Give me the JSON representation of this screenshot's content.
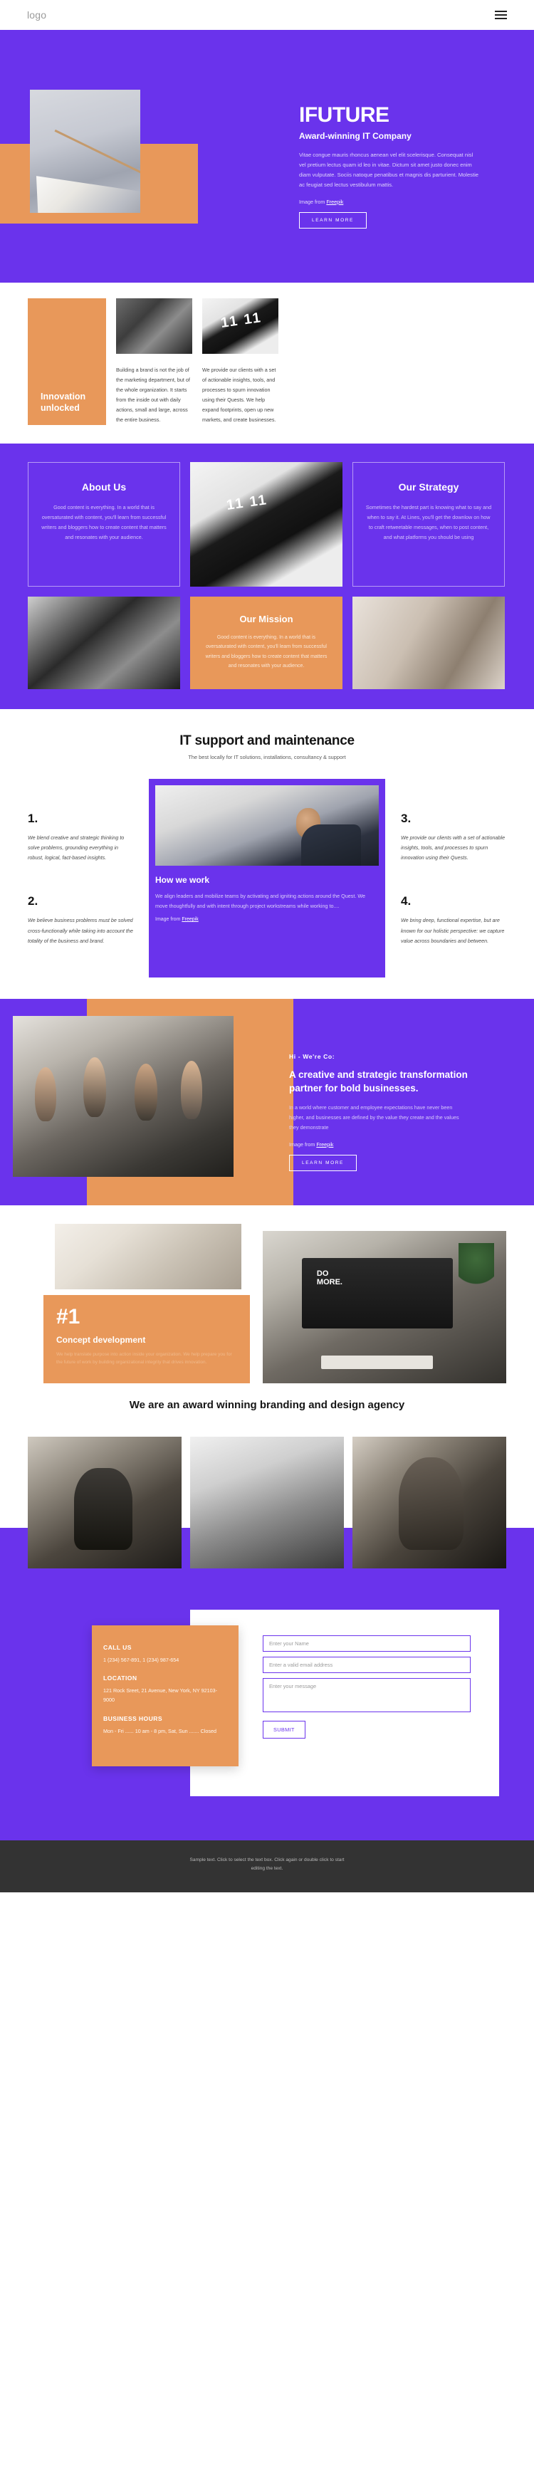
{
  "header": {
    "logo": "logo",
    "menu_icon": "hamburger-icon"
  },
  "hero": {
    "title": "IFUTURE",
    "subtitle": "Award-winning IT Company",
    "paragraph": "Vitae congue mauris rhoncus aenean vel elit scelerisque. Consequat nisl vel pretium lectus quam id leo in vitae. Dictum sit amet justo donec enim diam vulputate. Sociis natoque penatibus et magnis dis parturient. Molestie ac feugiat sed lectus vestibulum mattis.",
    "credit_prefix": "Image from ",
    "credit_link": "Freepik",
    "cta": "LEARN MORE"
  },
  "innovation": {
    "heading": "Innovation unlocked",
    "columns": [
      "Building a brand is not the job of the marketing department, but of the whole organization. It starts from the inside out with daily actions, small and large, across the entire business.",
      "We provide our clients with a set of actionable insights, tools, and processes to spurn innovation using their Quests. We help expand footprints, open up new markets, and create businesses."
    ]
  },
  "about": {
    "cards": [
      {
        "title": "About Us",
        "text": "Good content is everything. In a world that is oversaturated with content, you'll learn from successful writers and bloggers how to create content that matters and resonates with your audience."
      },
      {
        "title": "Our Strategy",
        "text": "Sometimes the hardest part is knowing what to say and when to say it. At Lines, you'll get the downlow on how to craft retweetable messages, when to post content, and what platforms you should be using"
      }
    ],
    "mission": {
      "title": "Our Mission",
      "text": "Good content is everything. In a world that is oversaturated with content, you'll learn from successful writers and bloggers how to create content that matters and resonates with your audience."
    }
  },
  "support": {
    "title": "IT support and maintenance",
    "lead": "The best locally for IT solutions, installations, consultancy & support",
    "items": [
      {
        "num": "1.",
        "text": "We blend creative and strategic thinking to solve problems, grounding everything in robust, logical, fact-based insights."
      },
      {
        "num": "2.",
        "text": "We believe business problems must be solved cross-functionally while taking into account the totality of the business and brand."
      },
      {
        "num": "3.",
        "text": "We provide our clients with a set of actionable insights, tools, and processes to spurn innovation using their Quests."
      },
      {
        "num": "4.",
        "text": "We bring deep, functional expertise, but are known for our holistic perspective: we capture value across boundaries and between."
      }
    ],
    "work": {
      "title": "How we work",
      "text": "We align leaders and mobilize teams by activating and igniting actions around the Quest. We move thoughtfully and with intent through project workstreams while working to....",
      "credit_prefix": "Image from ",
      "credit_link": "Freepik"
    }
  },
  "creative": {
    "eyebrow": "Hi - We're Co:",
    "title": "A creative and strategic transformation partner for bold businesses.",
    "text": "In a world where customer and employee expectations have never been higher, and businesses are defined by the value they create and the values they demonstrate",
    "credit_prefix": "Image from ",
    "credit_link": "Freepik",
    "cta": "LEARN MORE"
  },
  "concept": {
    "hash": "#1",
    "title": "Concept development",
    "text": "We help translate purpose into action inside your organization. We help prepare you for the future of work by building organizational integrity that drives innovation.",
    "award_line": "We are an award winning branding and design agency"
  },
  "contact": {
    "call_label": "CALL US",
    "call_value": "1 (234) 567-891, 1 (234) 987-654",
    "location_label": "LOCATION",
    "location_value": "121 Rock Sreet, 21 Avenue, New York, NY 92103-9000",
    "hours_label": "BUSINESS HOURS",
    "hours_value": "Mon - Fri ...... 10 am - 8 pm, Sat, Sun ....... Closed",
    "name_placeholder": "Enter your Name",
    "email_placeholder": "Enter a valid email address",
    "message_placeholder": "Enter your message",
    "submit": "SUBMIT"
  },
  "footer": {
    "text": "Sample text. Click to select the text box. Click again or double click to start editing the text."
  },
  "colors": {
    "purple": "#6a33ec",
    "orange": "#e8985a",
    "dark": "#333333"
  }
}
